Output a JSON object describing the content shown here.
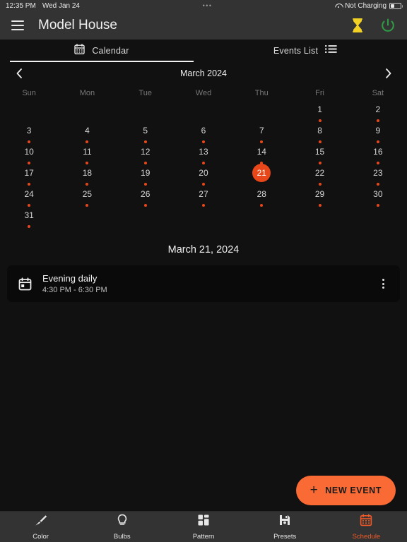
{
  "status_bar": {
    "time": "12:35 PM",
    "date": "Wed Jan 24",
    "center_dots": "•••",
    "wifi_icon": "wifi-icon",
    "battery_text": "Not Charging",
    "battery_icon": "battery-icon"
  },
  "app_bar": {
    "menu_icon": "hamburger-menu-icon",
    "title": "Model House",
    "timer_icon": "hourglass-icon",
    "power_icon": "power-icon",
    "timer_color": "#f2d024",
    "power_color": "#2e9e44"
  },
  "tabs": {
    "calendar": {
      "label": "Calendar",
      "icon": "calendar-icon",
      "active": true
    },
    "events_list": {
      "label": "Events List",
      "icon": "list-icon",
      "active": false
    }
  },
  "month_nav": {
    "prev_icon": "chevron-left-icon",
    "next_icon": "chevron-right-icon",
    "title": "March 2024"
  },
  "calendar": {
    "weekdays": [
      "Sun",
      "Mon",
      "Tue",
      "Wed",
      "Thu",
      "Fri",
      "Sat"
    ],
    "leading_blanks": 5,
    "days": [
      {
        "num": "1",
        "has_event": true,
        "selected": false
      },
      {
        "num": "2",
        "has_event": true,
        "selected": false
      },
      {
        "num": "3",
        "has_event": true,
        "selected": false
      },
      {
        "num": "4",
        "has_event": true,
        "selected": false
      },
      {
        "num": "5",
        "has_event": true,
        "selected": false
      },
      {
        "num": "6",
        "has_event": true,
        "selected": false
      },
      {
        "num": "7",
        "has_event": true,
        "selected": false
      },
      {
        "num": "8",
        "has_event": true,
        "selected": false
      },
      {
        "num": "9",
        "has_event": true,
        "selected": false
      },
      {
        "num": "10",
        "has_event": true,
        "selected": false
      },
      {
        "num": "11",
        "has_event": true,
        "selected": false
      },
      {
        "num": "12",
        "has_event": true,
        "selected": false
      },
      {
        "num": "13",
        "has_event": true,
        "selected": false
      },
      {
        "num": "14",
        "has_event": true,
        "selected": false
      },
      {
        "num": "15",
        "has_event": true,
        "selected": false
      },
      {
        "num": "16",
        "has_event": true,
        "selected": false
      },
      {
        "num": "17",
        "has_event": true,
        "selected": false
      },
      {
        "num": "18",
        "has_event": true,
        "selected": false
      },
      {
        "num": "19",
        "has_event": true,
        "selected": false
      },
      {
        "num": "20",
        "has_event": true,
        "selected": false
      },
      {
        "num": "21",
        "has_event": false,
        "selected": true
      },
      {
        "num": "22",
        "has_event": true,
        "selected": false
      },
      {
        "num": "23",
        "has_event": true,
        "selected": false
      },
      {
        "num": "24",
        "has_event": true,
        "selected": false
      },
      {
        "num": "25",
        "has_event": true,
        "selected": false
      },
      {
        "num": "26",
        "has_event": true,
        "selected": false
      },
      {
        "num": "27",
        "has_event": true,
        "selected": false
      },
      {
        "num": "28",
        "has_event": true,
        "selected": false
      },
      {
        "num": "29",
        "has_event": true,
        "selected": false
      },
      {
        "num": "30",
        "has_event": true,
        "selected": false
      },
      {
        "num": "31",
        "has_event": true,
        "selected": false
      }
    ],
    "selected_color": "#e8471a",
    "event_dot_color": "#e8471a"
  },
  "selected_date_label": "March 21, 2024",
  "events": [
    {
      "icon": "calendar-event-icon",
      "title": "Evening daily",
      "time": "4:30 PM - 6:30 PM",
      "menu_icon": "kebab-menu-icon"
    }
  ],
  "fab": {
    "plus_icon": "plus-icon",
    "label": "NEW EVENT",
    "color": "#f96a34"
  },
  "bottom_nav": {
    "items": [
      {
        "label": "Color",
        "icon": "brush-icon",
        "active": false
      },
      {
        "label": "Bulbs",
        "icon": "bulb-icon",
        "active": false
      },
      {
        "label": "Pattern",
        "icon": "grid-icon",
        "active": false
      },
      {
        "label": "Presets",
        "icon": "save-icon",
        "active": false
      },
      {
        "label": "Schedule",
        "icon": "calendar-icon",
        "active": true
      }
    ],
    "active_color": "#f05a28"
  }
}
